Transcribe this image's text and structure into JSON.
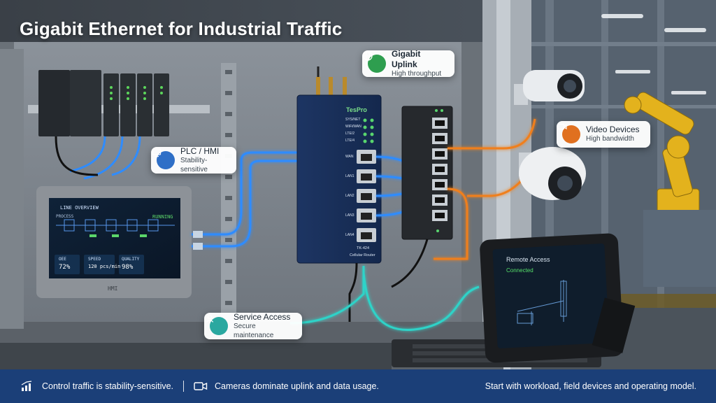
{
  "title": "Gigabit Ethernet for Industrial Traffic",
  "callouts": {
    "uplink": {
      "heading": "Gigabit Uplink",
      "sub": "High throughput",
      "icon": "globe-icon",
      "color": "#2e9e4f"
    },
    "plc": {
      "heading": "PLC / HMI",
      "sub": "Stability-sensitive",
      "icon": "monitor-icon",
      "color": "#2f6fc7"
    },
    "video": {
      "heading": "Video Devices",
      "sub": "High bandwidth",
      "icon": "camera-icon",
      "color": "#e0701f"
    },
    "service": {
      "heading": "Service Access",
      "sub": "Secure maintenance",
      "icon": "user-icon",
      "color": "#2aa8a0"
    }
  },
  "hmi": {
    "header": "LINE OVERVIEW",
    "process_label": "PROCESS",
    "status": "RUNNING",
    "stats": [
      {
        "label": "OEE",
        "value": "72%"
      },
      {
        "label": "SPEED",
        "value": "120 pcs/min"
      },
      {
        "label": "QUALITY",
        "value": "98%"
      }
    ],
    "brand": "HMI"
  },
  "router": {
    "brand": "TesPro",
    "leds": [
      "SYS/NET",
      "WiFi/WAN",
      "LTE/2",
      "LTE/4"
    ],
    "ports": [
      "WAN",
      "LAN1",
      "LAN2",
      "LAN3",
      "LAN4"
    ],
    "model": "TK-424",
    "caption": "Cellular Router"
  },
  "tablet": {
    "title": "Remote Access",
    "status": "Connected"
  },
  "colors": {
    "control": "#2f8cff",
    "video": "#f07f1f",
    "service": "#2fd3c8",
    "footer": "#1b3f78"
  },
  "footer": {
    "control_icon": "bar-chart-icon",
    "control_text": "Control traffic is stability-sensitive.",
    "camera_icon": "video-camera-icon",
    "camera_text": "Cameras dominate uplink and data usage.",
    "right_text": "Start with workload, field devices and operating model."
  }
}
